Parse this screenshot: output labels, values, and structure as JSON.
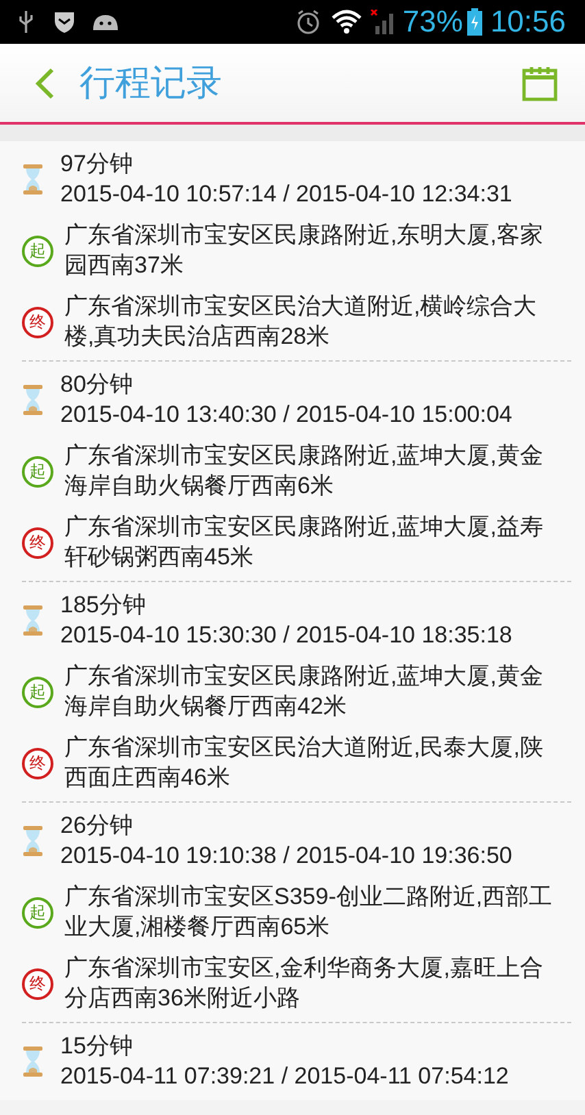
{
  "status_bar": {
    "battery": "73%",
    "time": "10:56"
  },
  "header": {
    "title": "行程记录"
  },
  "trips": [
    {
      "duration": "97分钟",
      "times": "2015-04-10 10:57:14 / 2015-04-10 12:34:31",
      "points": [
        {
          "kind": "start",
          "badge": "起",
          "address": "广东省深圳市宝安区民康路附近,东明大厦,客家园西南37米"
        },
        {
          "kind": "end",
          "badge": "终",
          "address": "广东省深圳市宝安区民治大道附近,横岭综合大楼,真功夫民治店西南28米"
        }
      ]
    },
    {
      "duration": "80分钟",
      "times": "2015-04-10 13:40:30 / 2015-04-10 15:00:04",
      "points": [
        {
          "kind": "start",
          "badge": "起",
          "address": "广东省深圳市宝安区民康路附近,蓝坤大厦,黄金海岸自助火锅餐厅西南6米"
        },
        {
          "kind": "end",
          "badge": "终",
          "address": "广东省深圳市宝安区民康路附近,蓝坤大厦,益寿轩砂锅粥西南45米"
        }
      ]
    },
    {
      "duration": "185分钟",
      "times": "2015-04-10 15:30:30 / 2015-04-10 18:35:18",
      "points": [
        {
          "kind": "start",
          "badge": "起",
          "address": "广东省深圳市宝安区民康路附近,蓝坤大厦,黄金海岸自助火锅餐厅西南42米"
        },
        {
          "kind": "end",
          "badge": "终",
          "address": "广东省深圳市宝安区民治大道附近,民泰大厦,陕西面庄西南46米"
        }
      ]
    },
    {
      "duration": "26分钟",
      "times": "2015-04-10 19:10:38 / 2015-04-10 19:36:50",
      "points": [
        {
          "kind": "start",
          "badge": "起",
          "address": "广东省深圳市宝安区S359-创业二路附近,西部工业大厦,湘楼餐厅西南65米"
        },
        {
          "kind": "end",
          "badge": "终",
          "address": "广东省深圳市宝安区,金利华商务大厦,嘉旺上合分店西南36米附近小路"
        }
      ]
    },
    {
      "duration": "15分钟",
      "times": "2015-04-11 07:39:21 / 2015-04-11 07:54:12"
    }
  ]
}
